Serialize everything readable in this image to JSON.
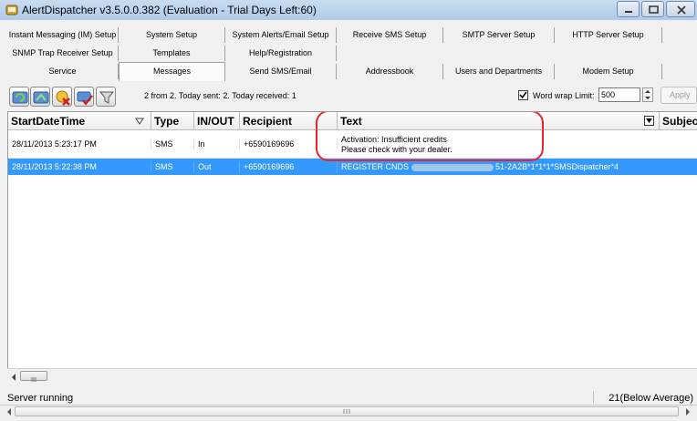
{
  "window": {
    "title": "AlertDispatcher v3.5.0.0.382 (Evaluation - Trial Days Left:60)"
  },
  "tabs": {
    "row1": [
      "Instant Messaging (IM) Setup",
      "System Setup",
      "System Alerts/Email Setup",
      "Receive SMS Setup",
      "SMTP Server Setup",
      "HTTP Server Setup"
    ],
    "row2": [
      "SNMP Trap Receiver Setup",
      "Templates",
      "Help/Registration"
    ],
    "row3": [
      "Service",
      "Messages",
      "Send SMS/Email",
      "Addressbook",
      "Users and Departments",
      "Modem Setup"
    ]
  },
  "toolbar": {
    "summary": "2 from 2. Today sent: 2. Today received: 1",
    "word_wrap_label": "Word wrap",
    "word_wrap_checked": true,
    "limit_label": "Limit:",
    "limit_value": "500",
    "apply_label": "Apply"
  },
  "grid": {
    "columns": [
      "StartDateTime",
      "Type",
      "IN/OUT",
      "Recipient",
      "Text",
      "Subjec"
    ],
    "rows": [
      {
        "start": "28/11/2013 5:23:17 PM",
        "type": "SMS",
        "inout": "In",
        "recipient": "+6590169696",
        "text_line1": "Activation: Insufficient credits",
        "text_line2": "Please check with your dealer."
      },
      {
        "start": "28/11/2013 5:22:38 PM",
        "type": "SMS",
        "inout": "Out",
        "recipient": "+6590169696",
        "text_before": "REGISTER CNDS",
        "text_after": "51-2A2B*1*1*1*SMSDispatcher*4"
      }
    ]
  },
  "status": {
    "left": "Server running",
    "right": "21(Below Average)"
  },
  "colors": {
    "selection": "#3399ff",
    "highlight_circle": "#e8262b"
  }
}
